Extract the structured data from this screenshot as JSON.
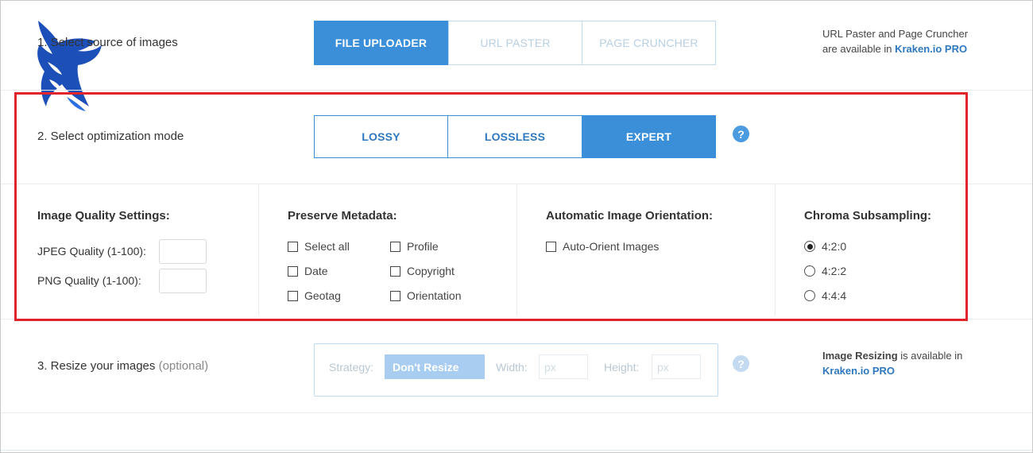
{
  "step1": {
    "label": "1. Select source of images",
    "tabs": [
      {
        "label": "FILE UPLOADER",
        "active": true
      },
      {
        "label": "URL PASTER",
        "active": false
      },
      {
        "label": "PAGE CRUNCHER",
        "active": false
      }
    ],
    "note_text": "URL Paster and Page Cruncher",
    "note_text2": "are available in",
    "note_link": "Kraken.io PRO"
  },
  "step2": {
    "label": "2. Select optimization mode",
    "modes": [
      {
        "label": "LOSSY",
        "active": false
      },
      {
        "label": "LOSSLESS",
        "active": false
      },
      {
        "label": "EXPERT",
        "active": true
      }
    ],
    "help_glyph": "?"
  },
  "quality": {
    "title": "Image Quality Settings:",
    "jpeg_label": "JPEG Quality (1-100):",
    "png_label": "PNG Quality (1-100):",
    "jpeg_value": "",
    "png_value": ""
  },
  "metadata": {
    "title": "Preserve Metadata:",
    "options": [
      "Select all",
      "Profile",
      "Date",
      "Copyright",
      "Geotag",
      "Orientation"
    ]
  },
  "orientation": {
    "title": "Automatic Image Orientation:",
    "option": "Auto-Orient Images"
  },
  "chroma": {
    "title": "Chroma Subsampling:",
    "options": [
      {
        "label": "4:2:0",
        "selected": true
      },
      {
        "label": "4:2:2",
        "selected": false
      },
      {
        "label": "4:4:4",
        "selected": false
      }
    ]
  },
  "step3": {
    "label": "3. Resize your images",
    "label_optional": "(optional)",
    "strategy_label": "Strategy:",
    "strategy_value": "Don't Resize",
    "width_label": "Width:",
    "height_label": "Height:",
    "px_placeholder": "px",
    "help_glyph": "?",
    "note_bold": "Image Resizing",
    "note_text": "is available in",
    "note_link": "Kraken.io PRO"
  },
  "colors": {
    "accent": "#3b8fd9",
    "highlight_box": "#e1232c"
  }
}
